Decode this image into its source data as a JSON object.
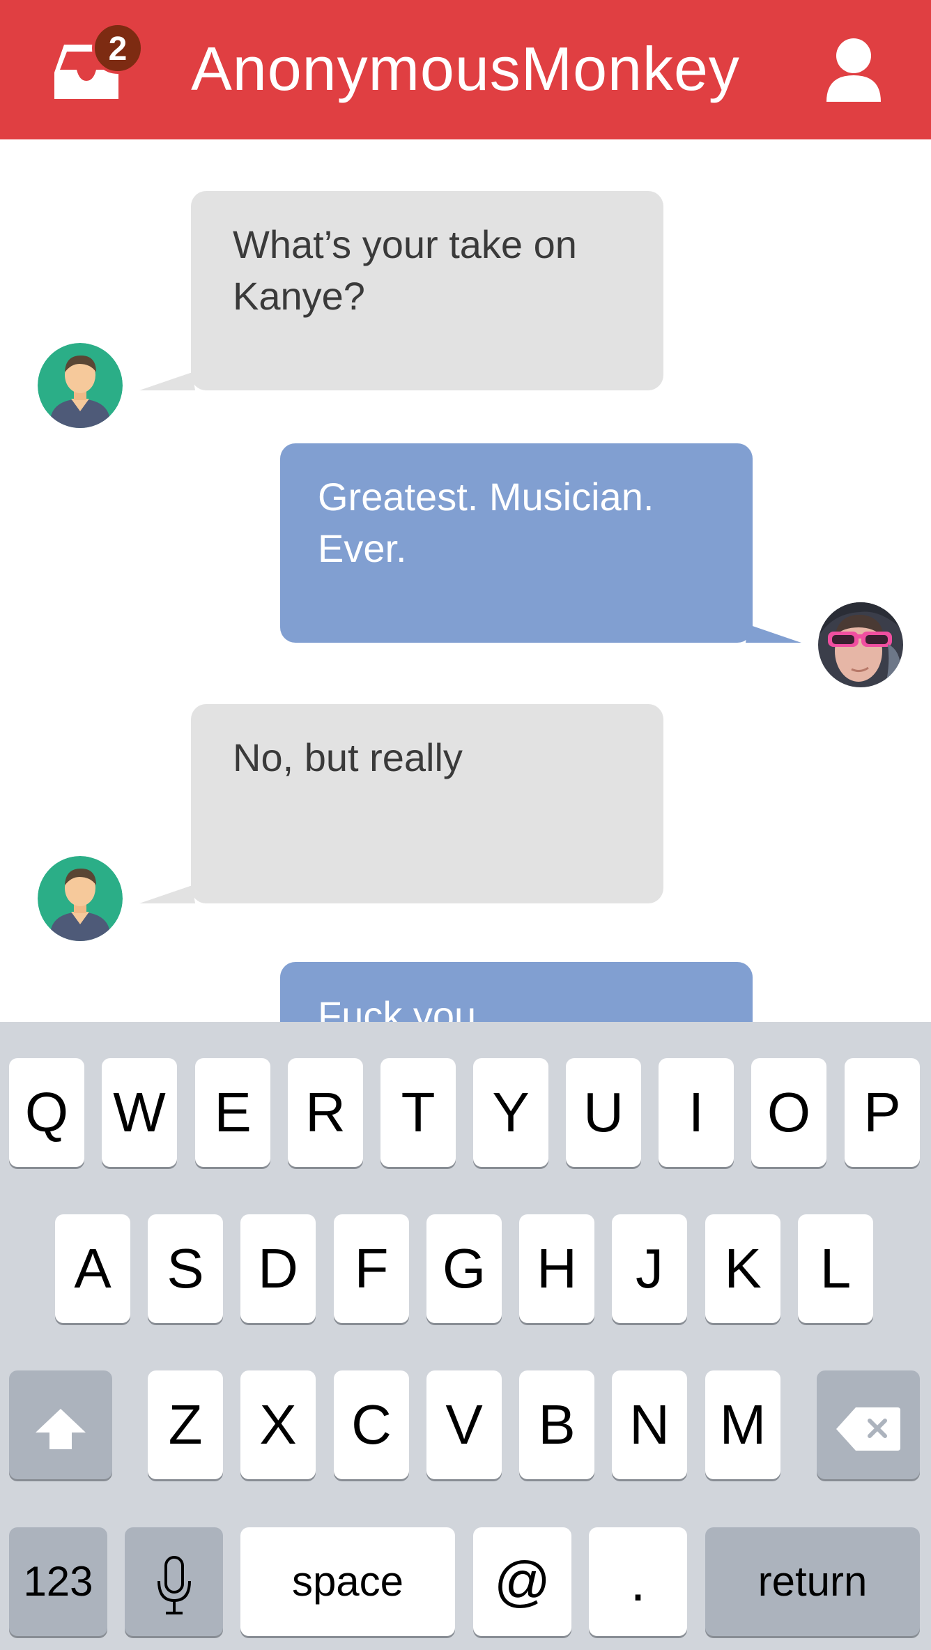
{
  "header": {
    "title": "AnonymousMonkey",
    "inbox_badge": "2",
    "accent_color": "#e03f42",
    "left_icon": "inbox-icon",
    "right_icon": "user-icon"
  },
  "messages": [
    {
      "direction": "incoming",
      "text_line1": "What’s your take on",
      "text_line2": "Kanye?",
      "avatar": "generic-user-avatar"
    },
    {
      "direction": "outgoing",
      "text_line1": "Greatest. Musician.",
      "text_line2": "Ever.",
      "avatar": "user-photo-pink-sunglasses"
    },
    {
      "direction": "incoming",
      "text_line1": "No, but really",
      "text_line2": "",
      "avatar": "generic-user-avatar"
    },
    {
      "direction": "outgoing",
      "text_line1": "Fuck you",
      "text_line2": "",
      "avatar": ""
    }
  ],
  "keyboard": {
    "row1": [
      "Q",
      "W",
      "E",
      "R",
      "T",
      "Y",
      "U",
      "I",
      "O",
      "P"
    ],
    "row2": [
      "A",
      "S",
      "D",
      "F",
      "G",
      "H",
      "J",
      "K",
      "L"
    ],
    "row3": [
      "Z",
      "X",
      "C",
      "V",
      "B",
      "N",
      "M"
    ],
    "shift_icon": "shift-icon",
    "delete_icon": "backspace-icon",
    "numbers_label": "123",
    "mic_icon": "microphone-icon",
    "space_label": "space",
    "at_label": "@",
    "period_label": ".",
    "return_label": "return"
  }
}
